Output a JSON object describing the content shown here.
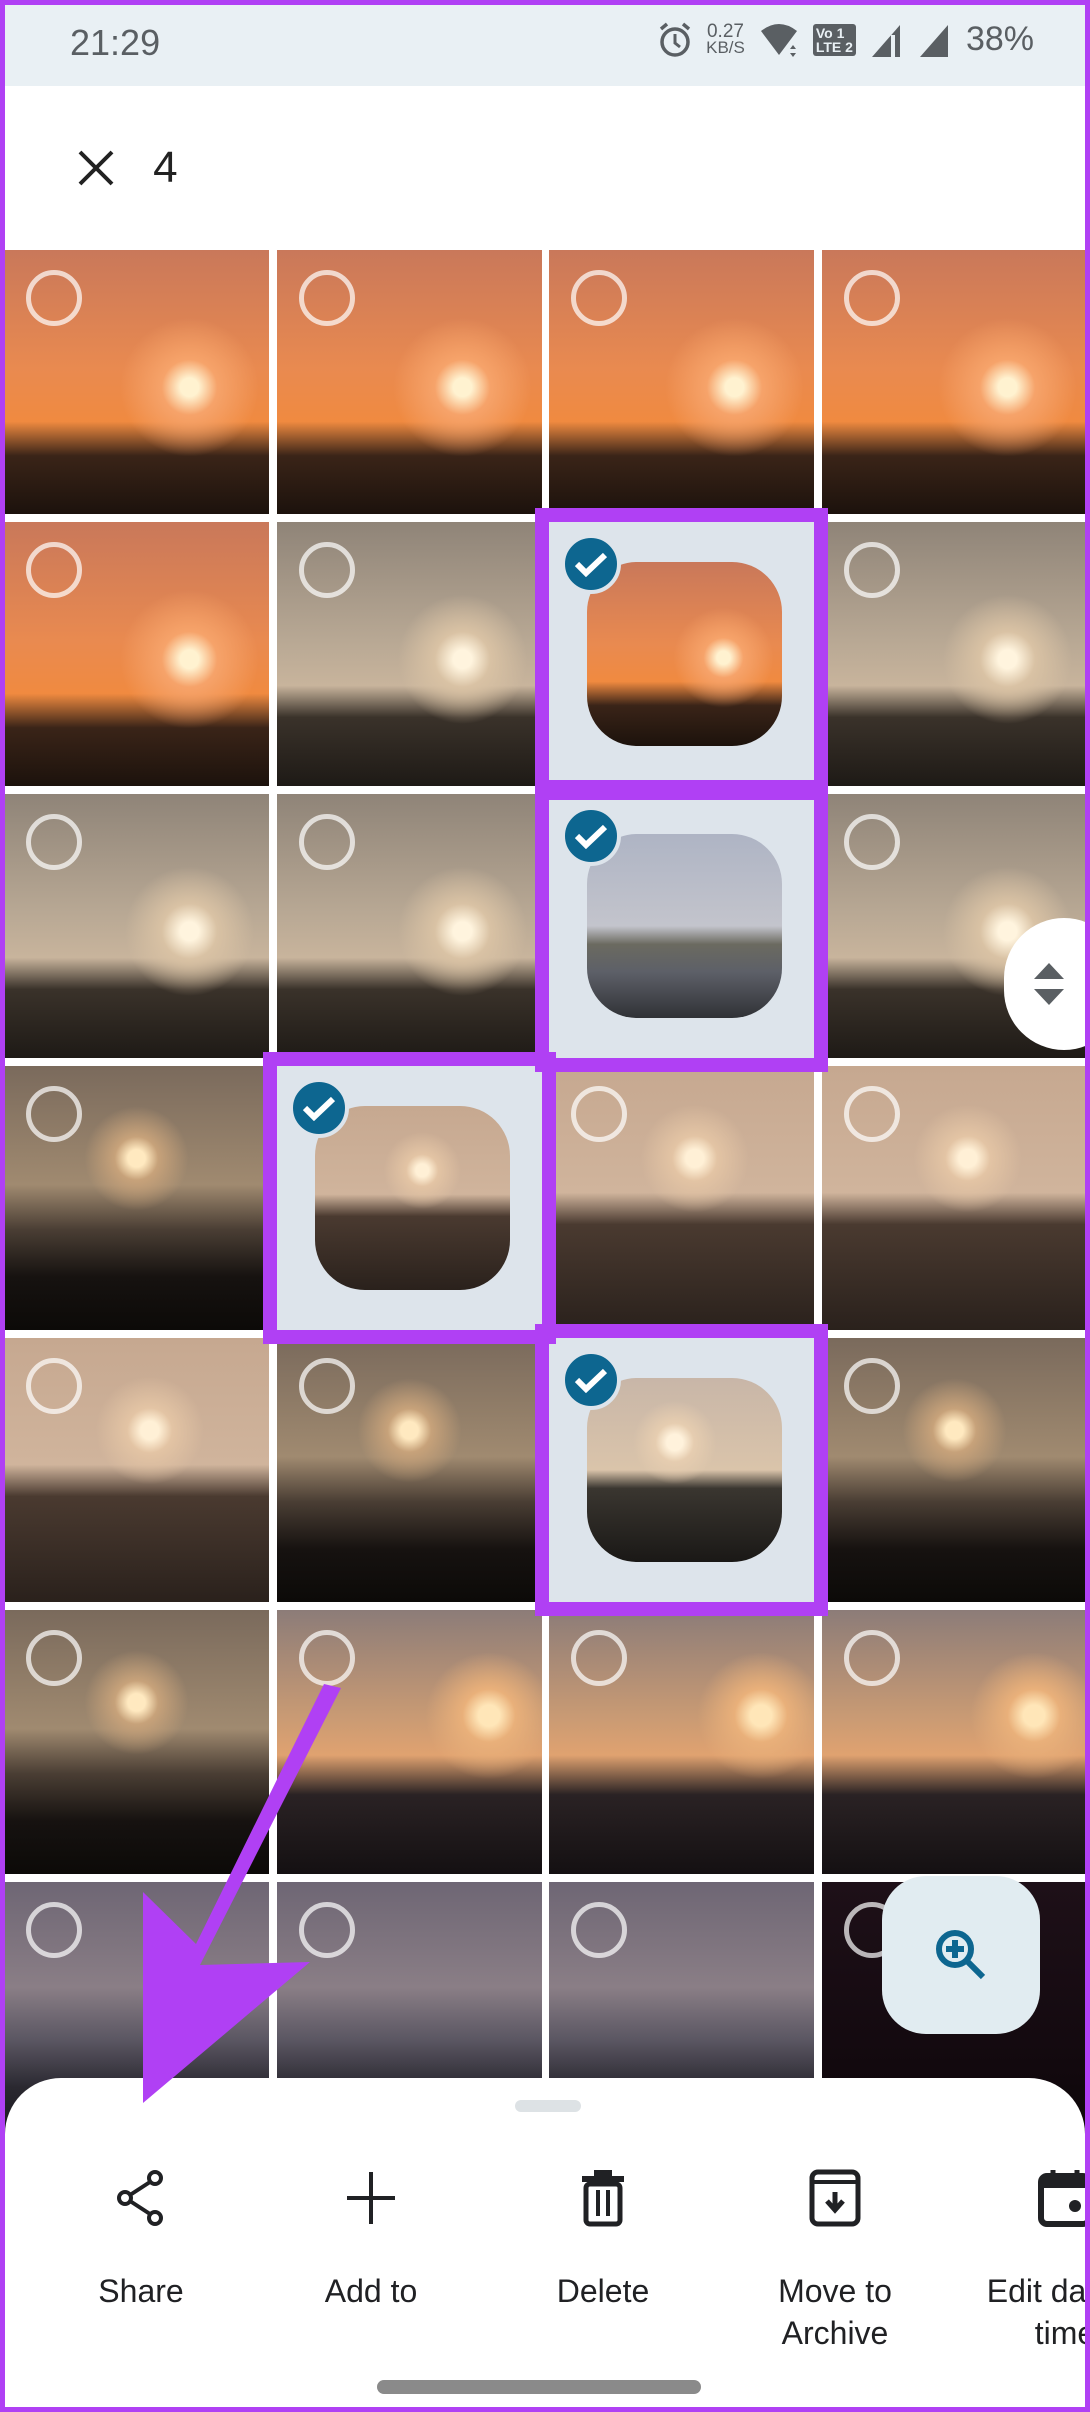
{
  "status_bar": {
    "time": "21:29",
    "net_speed_value": "0.27",
    "net_speed_unit": "KB/S",
    "volte_top": "Vo 1",
    "volte_bottom": "LTE 2",
    "battery": "38%"
  },
  "selection": {
    "count": "4",
    "close_icon": "close-icon"
  },
  "grid": {
    "rows": [
      [
        {
          "theme": "bridge-yellow",
          "selected": false
        },
        {
          "theme": "bridge-yellow",
          "selected": false
        },
        {
          "theme": "bridge-yellow",
          "selected": false
        },
        {
          "theme": "rock-dark",
          "selected": false
        }
      ],
      [
        {
          "theme": "orange-sunset",
          "selected": false
        },
        {
          "theme": "orange-sunset",
          "selected": false
        },
        {
          "theme": "orange-sunset",
          "selected": false
        },
        {
          "theme": "orange-sunset",
          "selected": false
        }
      ],
      [
        {
          "theme": "orange-sunset",
          "selected": false
        },
        {
          "theme": "grey-sunset",
          "selected": false
        },
        {
          "theme": "orange-sunset",
          "selected": true
        },
        {
          "theme": "grey-sunset",
          "selected": false
        }
      ],
      [
        {
          "theme": "grey-sunset",
          "selected": false
        },
        {
          "theme": "grey-sunset",
          "selected": false
        },
        {
          "theme": "misty-shore",
          "selected": true
        },
        {
          "theme": "grey-sunset",
          "selected": false
        }
      ],
      [
        {
          "theme": "dark-sea",
          "selected": false
        },
        {
          "theme": "beige-bridge",
          "selected": true
        },
        {
          "theme": "beige-bridge",
          "selected": false
        },
        {
          "theme": "beige-bridge",
          "selected": false
        }
      ],
      [
        {
          "theme": "beige-bridge",
          "selected": false
        },
        {
          "theme": "dark-sea",
          "selected": false
        },
        {
          "theme": "beige-rocks",
          "selected": true
        },
        {
          "theme": "dark-sea",
          "selected": false
        }
      ],
      [
        {
          "theme": "dark-sea",
          "selected": false
        },
        {
          "theme": "gazebo",
          "selected": false
        },
        {
          "theme": "gazebo",
          "selected": false
        },
        {
          "theme": "gazebo",
          "selected": false
        }
      ],
      [
        {
          "theme": "gazebo-dusk",
          "selected": false
        },
        {
          "theme": "gazebo-dusk",
          "selected": false
        },
        {
          "theme": "gazebo-dusk",
          "selected": false
        },
        {
          "theme": "night",
          "selected": false
        }
      ]
    ]
  },
  "actions": [
    {
      "label": "Share",
      "icon": "share-icon"
    },
    {
      "label": "Add to",
      "icon": "plus-icon"
    },
    {
      "label": "Delete",
      "icon": "trash-icon"
    },
    {
      "label": "Move to\nArchive",
      "icon": "archive-icon"
    },
    {
      "label": "Edit date &\ntime",
      "icon": "calendar-icon"
    }
  ],
  "colors": {
    "accent": "#0d6690",
    "annotation": "#b040f4",
    "selected_bg": "#dde4eb"
  }
}
